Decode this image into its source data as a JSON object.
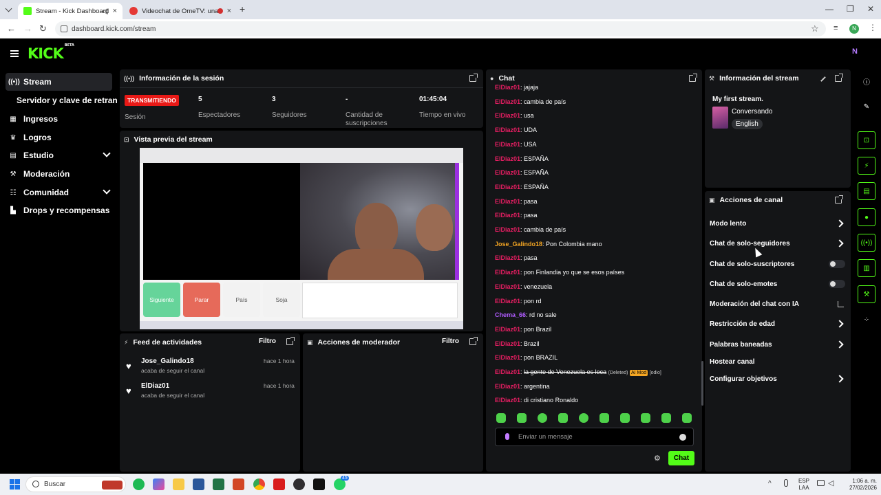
{
  "browser": {
    "tabs": [
      {
        "title": "Stream - Kick Dashboard"
      },
      {
        "title": "Videochat de OmeTV: una"
      }
    ],
    "url": "dashboard.kick.com/stream",
    "profile_initial": "N"
  },
  "kick": {
    "logo": "KICK",
    "logo_badge": "BETA"
  },
  "sidebar": {
    "items": [
      {
        "label": "Stream",
        "icon": "broadcast-icon"
      },
      {
        "label": "Servidor y clave de retransmisión"
      },
      {
        "label": "Ingresos",
        "icon": "revenue-icon"
      },
      {
        "label": "Logros",
        "icon": "trophy-icon"
      },
      {
        "label": "Estudio",
        "icon": "studio-icon"
      },
      {
        "label": "Moderación",
        "icon": "wrench-icon"
      },
      {
        "label": "Comunidad",
        "icon": "community-icon"
      },
      {
        "label": "Drops y recompensas",
        "icon": "drops-icon"
      }
    ]
  },
  "session": {
    "title": "Información de la sesión",
    "status": "TRANSMITIENDO",
    "status_label": "Sesión",
    "stats": [
      {
        "value": "5",
        "label": "Espectadores"
      },
      {
        "value": "3",
        "label": "Seguidores"
      },
      {
        "value": "-",
        "label": "Cantidad de suscripciones"
      },
      {
        "value": "01:45:04",
        "label": "Tiempo en vivo"
      }
    ]
  },
  "preview": {
    "title": "Vista previa del stream",
    "buttons": [
      "Siguiente",
      "Parar",
      "País",
      "Soja"
    ]
  },
  "activity": {
    "title": "Feed de actividades",
    "filter": "Filtro",
    "items": [
      {
        "name": "Jose_Galindo18",
        "action": "acaba de seguir el canal",
        "time": "hace 1 hora"
      },
      {
        "name": "ElDiaz01",
        "action": "acaba de seguir el canal",
        "time": "hace 1 hora"
      }
    ]
  },
  "modactions": {
    "title": "Acciones de moderador",
    "filter": "Filtro"
  },
  "chat": {
    "title": "Chat",
    "messages": [
      {
        "user": "ElDiaz01",
        "text": "jajaja",
        "color": "#e91e63"
      },
      {
        "user": "ElDiaz01",
        "text": "cambia de país",
        "color": "#e91e63"
      },
      {
        "user": "ElDiaz01",
        "text": "usa",
        "color": "#e91e63"
      },
      {
        "user": "ElDiaz01",
        "text": "UDA",
        "color": "#e91e63"
      },
      {
        "user": "ElDiaz01",
        "text": "USA",
        "color": "#e91e63"
      },
      {
        "user": "ElDiaz01",
        "text": "ESPAÑA",
        "color": "#e91e63"
      },
      {
        "user": "ElDiaz01",
        "text": "ESPAÑA",
        "color": "#e91e63"
      },
      {
        "user": "ElDiaz01",
        "text": "ESPAÑA",
        "color": "#e91e63"
      },
      {
        "user": "ElDiaz01",
        "text": "pasa",
        "color": "#e91e63"
      },
      {
        "user": "ElDiaz01",
        "text": "pasa",
        "color": "#e91e63"
      },
      {
        "user": "ElDiaz01",
        "text": "cambia de país",
        "color": "#e91e63"
      },
      {
        "user": "Jose_Galindo18",
        "text": "Pon Colombia mano",
        "color": "#f5a623"
      },
      {
        "user": "ElDiaz01",
        "text": "pasa",
        "color": "#e91e63"
      },
      {
        "user": "ElDiaz01",
        "text": "pon Finlandia yo que se esos países",
        "color": "#e91e63"
      },
      {
        "user": "ElDiaz01",
        "text": "venezuela",
        "color": "#e91e63"
      },
      {
        "user": "ElDiaz01",
        "text": "pon rd",
        "color": "#e91e63"
      },
      {
        "user": "Chema_66",
        "text": "rd no sale",
        "color": "#b05cff"
      },
      {
        "user": "ElDiaz01",
        "text": "pon Brazil",
        "color": "#e91e63"
      },
      {
        "user": "ElDiaz01",
        "text": "Brazil",
        "color": "#e91e63"
      },
      {
        "user": "ElDiaz01",
        "text": "pon BRAZIL",
        "color": "#e91e63"
      },
      {
        "user": "ElDiaz01",
        "text": "la gente de Venezuela es loca",
        "color": "#e91e63",
        "deleted": "(Deleted)",
        "badge": "AI Mod",
        "reason": "[odio]"
      },
      {
        "user": "ElDiaz01",
        "text": "argentina",
        "color": "#e91e63"
      },
      {
        "user": "ElDiaz01",
        "text": "di cristiano Ronaldo",
        "color": "#e91e63"
      }
    ],
    "input_placeholder": "Enviar un mensaje",
    "send_label": "Chat"
  },
  "stream_info": {
    "title": "Información del stream",
    "stream_title": "My first stream.",
    "category": "Conversando",
    "language": "English"
  },
  "channel_actions": {
    "title": "Acciones de canal",
    "items": [
      {
        "label": "Modo lento",
        "control": "chevron"
      },
      {
        "label": "Chat de solo-seguidores",
        "control": "chevron"
      },
      {
        "label": "Chat de solo-suscriptores",
        "control": "toggle"
      },
      {
        "label": "Chat de solo-emotes",
        "control": "toggle"
      },
      {
        "label": "Moderación del chat con IA",
        "control": "external"
      },
      {
        "label": "Restricción de edad",
        "control": "chevron"
      },
      {
        "label": "Palabras baneadas",
        "control": "chevron"
      },
      {
        "label": "Hostear canal",
        "control": "none"
      },
      {
        "label": "Configurar objetivos",
        "control": "chevron"
      }
    ]
  },
  "taskbar": {
    "search": "Buscar",
    "lang": "ESP",
    "layout": "LAA",
    "time": "1:06 a. m.",
    "date": "27/02/2026",
    "whatsapp_badge": "45"
  },
  "colors": {
    "kick_green": "#53fc18",
    "live_red": "#e91916",
    "panel_bg": "#141517"
  }
}
